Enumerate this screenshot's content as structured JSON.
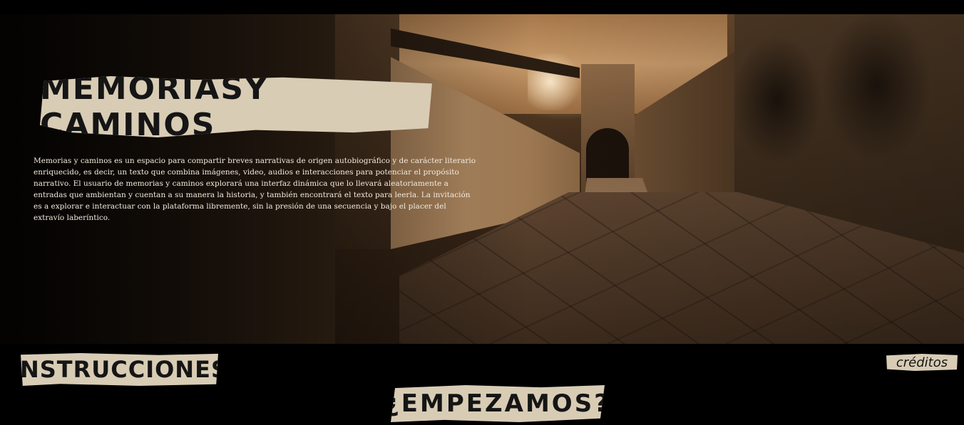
{
  "hero": {
    "title": "MEMORIASY CAMINOS",
    "description": "Memorias y caminos es un espacio para compartir breves narrativas de origen autobiográfico y de carácter literario enriquecido, es decir, un texto que combina imágenes, video, audios e interacciones para potenciar el propósito narrativo. El usuario de memorias y caminos explorará una interfaz dinámica que lo llevará aleatoriamente a entradas que ambientan y cuentan a su manera la historia, y también encontrará el texto para leerla. La invitación es a explorar e interactuar con la plataforma libremente, sin la presión de una secuencia y bajo el placer del extravío laberíntico."
  },
  "nav": {
    "instrucciones_label": "INSTRUCCIONES",
    "creditos_label": "créditos",
    "empezamos_label": "¿EMPEZAMOS?"
  },
  "colors": {
    "paper": "#d8ccb5",
    "ink": "#151515",
    "sepia": "#6a4a2c",
    "background": "#000000"
  }
}
